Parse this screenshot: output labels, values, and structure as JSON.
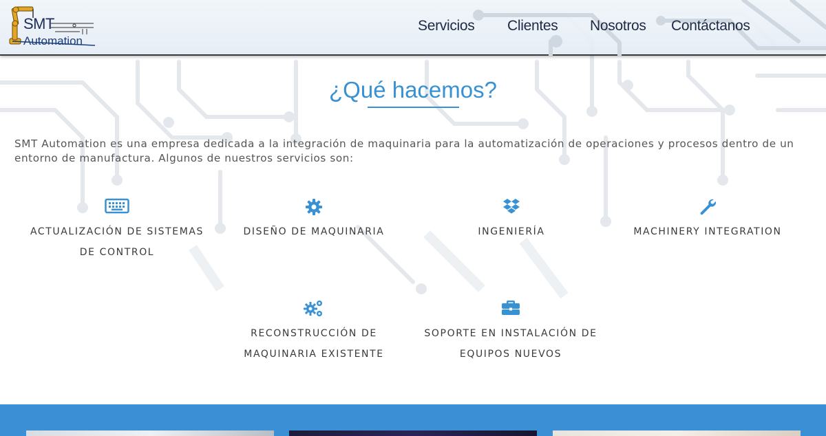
{
  "header": {
    "logo": {
      "line1": "SMT",
      "line2": "Automation"
    },
    "nav": [
      {
        "label": "Servicios"
      },
      {
        "label": "Clientes"
      },
      {
        "label": "Nosotros"
      },
      {
        "label": "Contáctanos"
      }
    ]
  },
  "main": {
    "title": "¿Qué hacemos?",
    "intro": "SMT Automation es una empresa dedicada a la integración de maquinaria para la automatización de operaciones y procesos dentro de un entorno de manufactura. Algunos de nuestros servicios son:",
    "services": [
      {
        "icon": "keyboard-icon",
        "line1": "ACTUALIZACIÓN DE SISTEMAS",
        "line2": "DE CONTROL"
      },
      {
        "icon": "gear-icon",
        "line1": "DISEÑO DE MAQUINARIA",
        "line2": ""
      },
      {
        "icon": "dropbox-icon",
        "line1": "INGENIERÍA",
        "line2": ""
      },
      {
        "icon": "wrench-icon",
        "line1": "MACHINERY INTEGRATION",
        "line2": ""
      },
      {
        "icon": "gears-icon",
        "line1": "RECONSTRUCCIÓN DE",
        "line2": "MAQUINARIA EXISTENTE"
      },
      {
        "icon": "briefcase-icon",
        "line1": "SOPORTE EN INSTALACIÓN DE",
        "line2": "EQUIPOS NUEVOS"
      }
    ]
  },
  "colors": {
    "accent": "#3791d2",
    "band": "#3b8fd4",
    "nav_text": "#1e2a44"
  }
}
